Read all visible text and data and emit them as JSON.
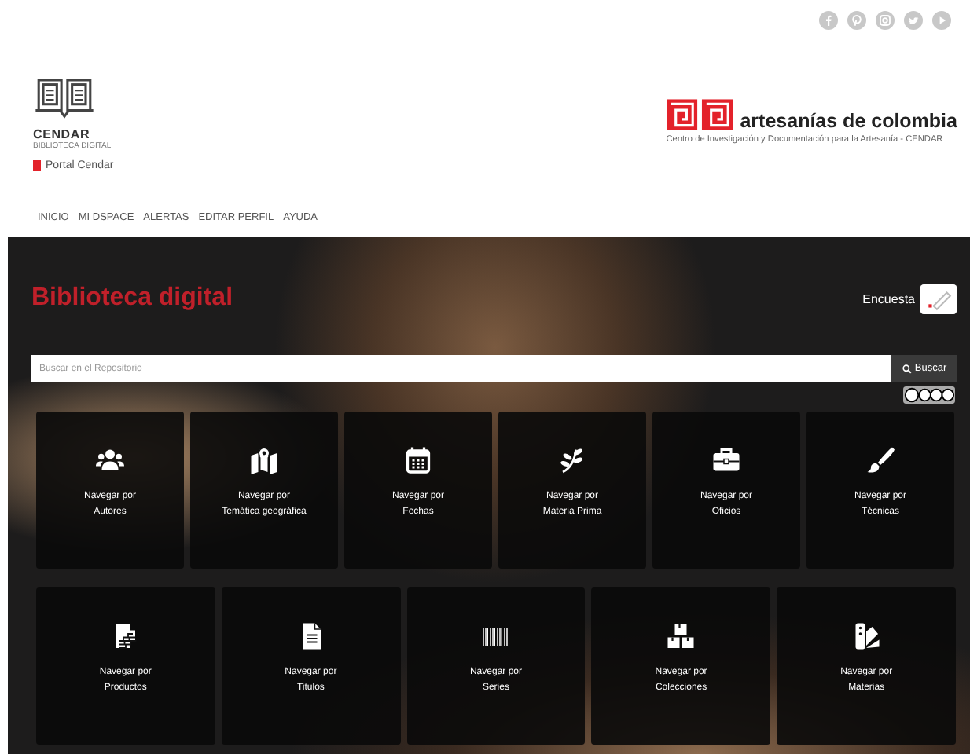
{
  "social_icons": [
    {
      "kind": "facebook"
    },
    {
      "kind": "pinterest"
    },
    {
      "kind": "instagram"
    },
    {
      "kind": "twitter"
    },
    {
      "kind": "youtube"
    }
  ],
  "header": {
    "logo_title": "CENDAR",
    "logo_subtitle": "BIBLIOTECA DIGITAL",
    "portal_link": "Portal Cendar",
    "brand_name": "artesanías de colombia",
    "brand_tagline": "Centro de Investigación y Documentación para la Artesanía - CENDAR"
  },
  "nav": [
    "INICIO",
    "MI DSPACE",
    "ALERTAS",
    "EDITAR PERFIL",
    "AYUDA"
  ],
  "hero": {
    "title": "Biblioteca digital",
    "survey_label": "Encuesta",
    "search": {
      "placeholder": "Buscar en el Repositorio",
      "button": "Buscar"
    }
  },
  "tiles_row_1": [
    {
      "kind": "people",
      "prefix": "Navegar por",
      "subject": "Autores"
    },
    {
      "kind": "map",
      "prefix": "Navegar por",
      "subject": "Temática geográfica"
    },
    {
      "kind": "calendar",
      "prefix": "Navegar por",
      "subject": "Fechas"
    },
    {
      "kind": "plant",
      "prefix": "Navegar por",
      "subject": "Materia Prima"
    },
    {
      "kind": "toolbox",
      "prefix": "Navegar por",
      "subject": "Oficios"
    },
    {
      "kind": "brush",
      "prefix": "Navegar por",
      "subject": "Técnicas"
    }
  ],
  "tiles_row_2": [
    {
      "kind": "layers",
      "prefix": "Navegar por",
      "subject": "Productos"
    },
    {
      "kind": "document",
      "prefix": "Navegar por",
      "subject": "Titulos"
    },
    {
      "kind": "barcode",
      "prefix": "Navegar por",
      "subject": "Series"
    },
    {
      "kind": "boxes",
      "prefix": "Navegar por",
      "subject": "Colecciones"
    },
    {
      "kind": "swatch",
      "prefix": "Navegar por",
      "subject": "Materias"
    }
  ]
}
